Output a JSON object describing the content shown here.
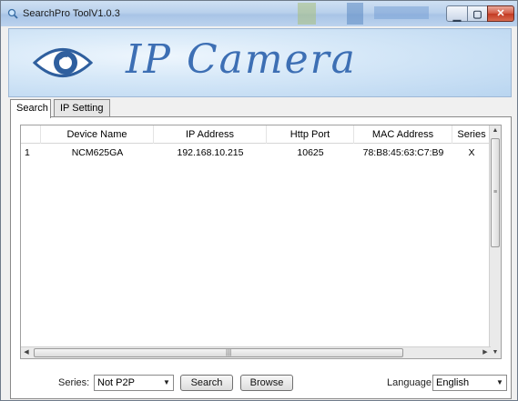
{
  "window": {
    "title": "SearchPro ToolV1.0.3",
    "accent": "#3d6fb4"
  },
  "banner": {
    "brand_text": "IP Camera"
  },
  "tabs": [
    {
      "label": "Search",
      "active": true
    },
    {
      "label": "IP Setting",
      "active": false
    }
  ],
  "grid": {
    "columns": [
      "Device Name",
      "IP Address",
      "Http Port",
      "MAC Address",
      "Series"
    ],
    "rows": [
      {
        "index": "1",
        "device_name": "NCM625GA",
        "ip_address": "192.168.10.215",
        "http_port": "10625",
        "mac_address": "78:B8:45:63:C7:B9",
        "series": "X"
      }
    ]
  },
  "controls": {
    "series_label": "Series:",
    "series_value": "Not P2P",
    "search_button": "Search",
    "browse_button": "Browse",
    "language_label": "Language",
    "language_value": "English"
  }
}
